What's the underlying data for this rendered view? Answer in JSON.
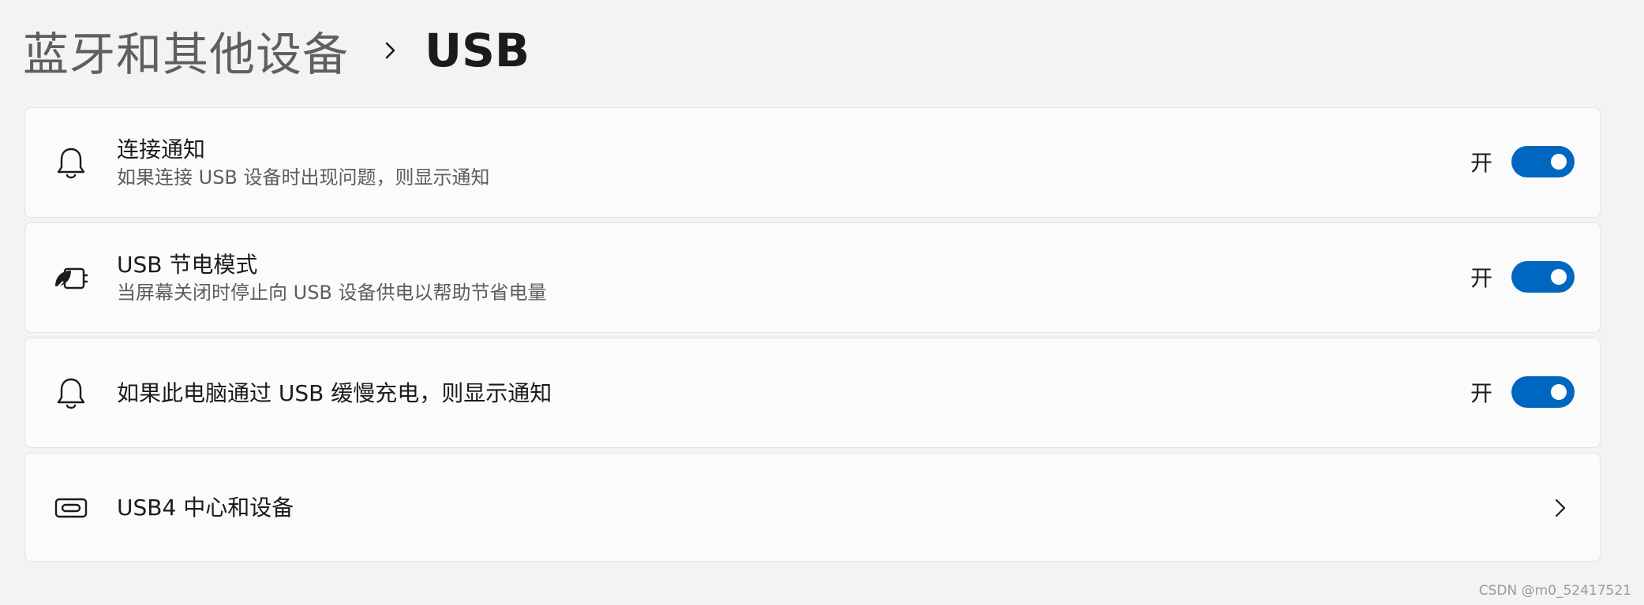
{
  "breadcrumb": {
    "parent": "蓝牙和其他设备",
    "separator_icon": "chevron-right-icon",
    "current": "USB"
  },
  "settings": [
    {
      "icon": "bell-icon",
      "title": "连接通知",
      "description": "如果连接 USB 设备时出现问题，则显示通知",
      "control": "toggle",
      "state_label": "开",
      "enabled": true
    },
    {
      "icon": "battery-saver-icon",
      "title": "USB 节电模式",
      "description": "当屏幕关闭时停止向 USB 设备供电以帮助节省电量",
      "control": "toggle",
      "state_label": "开",
      "enabled": true
    },
    {
      "icon": "bell-icon",
      "title": "如果此电脑通过 USB 缓慢充电，则显示通知",
      "control": "toggle",
      "state_label": "开",
      "enabled": true
    },
    {
      "icon": "usb-c-port-icon",
      "title": "USB4 中心和设备",
      "control": "chevron",
      "chevron_icon": "chevron-right-icon"
    }
  ],
  "colors": {
    "accent": "#0067c0",
    "background": "#f3f3f3",
    "card": "#fbfbfb"
  },
  "watermark": "CSDN @m0_52417521"
}
